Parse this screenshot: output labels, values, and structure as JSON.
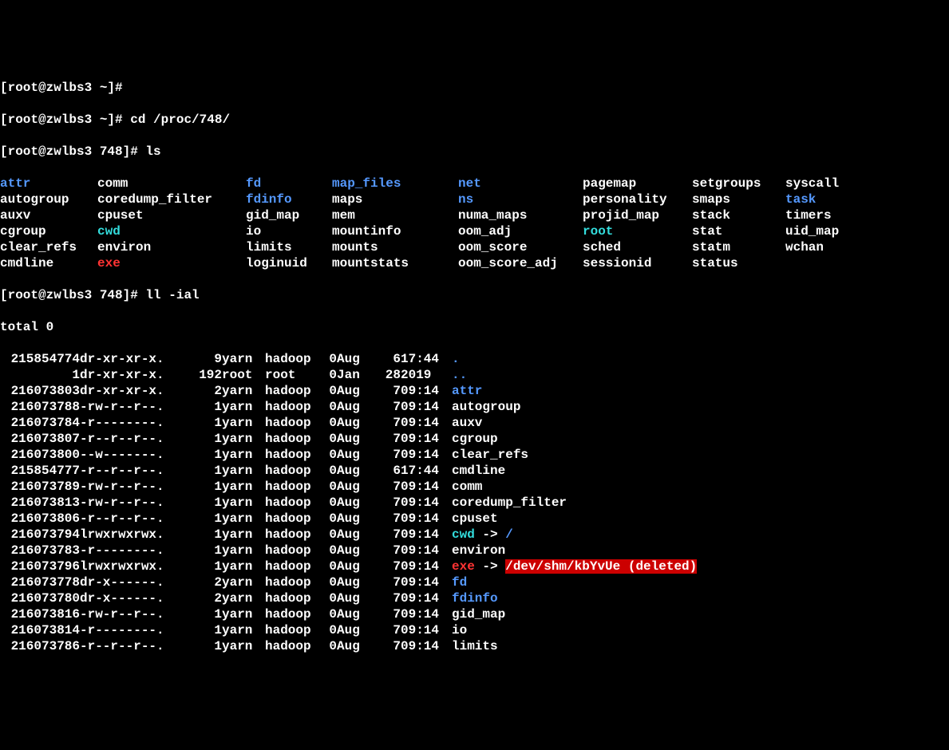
{
  "prompts": {
    "p0": "[root@zwlbs3 ~]# ",
    "p1": "[root@zwlbs3 ~]# cd /proc/748/",
    "p2": "[root@zwlbs3 748]# ls",
    "p3": "[root@zwlbs3 748]# ll -ial",
    "total": "total 0"
  },
  "ls": {
    "col1": [
      {
        "name": "attr",
        "cls": "blue"
      },
      {
        "name": "autogroup",
        "cls": "white"
      },
      {
        "name": "auxv",
        "cls": "white"
      },
      {
        "name": "cgroup",
        "cls": "white"
      },
      {
        "name": "clear_refs",
        "cls": "white"
      },
      {
        "name": "cmdline",
        "cls": "white"
      }
    ],
    "col2": [
      {
        "name": "comm",
        "cls": "white"
      },
      {
        "name": "coredump_filter",
        "cls": "white"
      },
      {
        "name": "cpuset",
        "cls": "white"
      },
      {
        "name": "cwd",
        "cls": "cyan"
      },
      {
        "name": "environ",
        "cls": "white"
      },
      {
        "name": "exe",
        "cls": "red"
      }
    ],
    "col3": [
      {
        "name": "fd",
        "cls": "blue"
      },
      {
        "name": "fdinfo",
        "cls": "blue"
      },
      {
        "name": "gid_map",
        "cls": "white"
      },
      {
        "name": "io",
        "cls": "white"
      },
      {
        "name": "limits",
        "cls": "white"
      },
      {
        "name": "loginuid",
        "cls": "white"
      }
    ],
    "col4": [
      {
        "name": "map_files",
        "cls": "blue"
      },
      {
        "name": "maps",
        "cls": "white"
      },
      {
        "name": "mem",
        "cls": "white"
      },
      {
        "name": "mountinfo",
        "cls": "white"
      },
      {
        "name": "mounts",
        "cls": "white"
      },
      {
        "name": "mountstats",
        "cls": "white"
      }
    ],
    "col5": [
      {
        "name": "net",
        "cls": "blue"
      },
      {
        "name": "ns",
        "cls": "blue"
      },
      {
        "name": "numa_maps",
        "cls": "white"
      },
      {
        "name": "oom_adj",
        "cls": "white"
      },
      {
        "name": "oom_score",
        "cls": "white"
      },
      {
        "name": "oom_score_adj",
        "cls": "white"
      }
    ],
    "col6": [
      {
        "name": "pagemap",
        "cls": "white"
      },
      {
        "name": "personality",
        "cls": "white"
      },
      {
        "name": "projid_map",
        "cls": "white"
      },
      {
        "name": "root",
        "cls": "cyan"
      },
      {
        "name": "sched",
        "cls": "white"
      },
      {
        "name": "sessionid",
        "cls": "white"
      }
    ],
    "col7": [
      {
        "name": "setgroups",
        "cls": "white"
      },
      {
        "name": "smaps",
        "cls": "white"
      },
      {
        "name": "stack",
        "cls": "white"
      },
      {
        "name": "stat",
        "cls": "white"
      },
      {
        "name": "statm",
        "cls": "white"
      },
      {
        "name": "status",
        "cls": "white"
      }
    ],
    "col8": [
      {
        "name": "syscall",
        "cls": "white"
      },
      {
        "name": "task",
        "cls": "blue"
      },
      {
        "name": "timers",
        "cls": "white"
      },
      {
        "name": "uid_map",
        "cls": "white"
      },
      {
        "name": "wchan",
        "cls": "white"
      }
    ]
  },
  "ll": [
    {
      "inode": "215854774",
      "perms": "dr-xr-xr-x.",
      "links": "9",
      "owner": "yarn",
      "group": "hadoop",
      "size": "0",
      "month": "Aug",
      "day": "6",
      "time": "17:44",
      "name": ".",
      "cls": "blue"
    },
    {
      "inode": "1",
      "perms": "dr-xr-xr-x.",
      "links": "192",
      "owner": "root",
      "group": "root",
      "size": "0",
      "month": "Jan",
      "day": "28",
      "time": "2019",
      "name": "..",
      "cls": "blue"
    },
    {
      "inode": "216073803",
      "perms": "dr-xr-xr-x.",
      "links": "2",
      "owner": "yarn",
      "group": "hadoop",
      "size": "0",
      "month": "Aug",
      "day": "7",
      "time": "09:14",
      "name": "attr",
      "cls": "blue"
    },
    {
      "inode": "216073788",
      "perms": "-rw-r--r--.",
      "links": "1",
      "owner": "yarn",
      "group": "hadoop",
      "size": "0",
      "month": "Aug",
      "day": "7",
      "time": "09:14",
      "name": "autogroup",
      "cls": "white"
    },
    {
      "inode": "216073784",
      "perms": "-r--------.",
      "links": "1",
      "owner": "yarn",
      "group": "hadoop",
      "size": "0",
      "month": "Aug",
      "day": "7",
      "time": "09:14",
      "name": "auxv",
      "cls": "white"
    },
    {
      "inode": "216073807",
      "perms": "-r--r--r--.",
      "links": "1",
      "owner": "yarn",
      "group": "hadoop",
      "size": "0",
      "month": "Aug",
      "day": "7",
      "time": "09:14",
      "name": "cgroup",
      "cls": "white"
    },
    {
      "inode": "216073800",
      "perms": "--w-------.",
      "links": "1",
      "owner": "yarn",
      "group": "hadoop",
      "size": "0",
      "month": "Aug",
      "day": "7",
      "time": "09:14",
      "name": "clear_refs",
      "cls": "white"
    },
    {
      "inode": "215854777",
      "perms": "-r--r--r--.",
      "links": "1",
      "owner": "yarn",
      "group": "hadoop",
      "size": "0",
      "month": "Aug",
      "day": "6",
      "time": "17:44",
      "name": "cmdline",
      "cls": "white"
    },
    {
      "inode": "216073789",
      "perms": "-rw-r--r--.",
      "links": "1",
      "owner": "yarn",
      "group": "hadoop",
      "size": "0",
      "month": "Aug",
      "day": "7",
      "time": "09:14",
      "name": "comm",
      "cls": "white"
    },
    {
      "inode": "216073813",
      "perms": "-rw-r--r--.",
      "links": "1",
      "owner": "yarn",
      "group": "hadoop",
      "size": "0",
      "month": "Aug",
      "day": "7",
      "time": "09:14",
      "name": "coredump_filter",
      "cls": "white"
    },
    {
      "inode": "216073806",
      "perms": "-r--r--r--.",
      "links": "1",
      "owner": "yarn",
      "group": "hadoop",
      "size": "0",
      "month": "Aug",
      "day": "7",
      "time": "09:14",
      "name": "cpuset",
      "cls": "white"
    },
    {
      "inode": "216073794",
      "perms": "lrwxrwxrwx.",
      "links": "1",
      "owner": "yarn",
      "group": "hadoop",
      "size": "0",
      "month": "Aug",
      "day": "7",
      "time": "09:14",
      "name": "cwd",
      "cls": "cyan",
      "arrow": " -> ",
      "target": "/",
      "tcls": "blue"
    },
    {
      "inode": "216073783",
      "perms": "-r--------.",
      "links": "1",
      "owner": "yarn",
      "group": "hadoop",
      "size": "0",
      "month": "Aug",
      "day": "7",
      "time": "09:14",
      "name": "environ",
      "cls": "white"
    },
    {
      "inode": "216073796",
      "perms": "lrwxrwxrwx.",
      "links": "1",
      "owner": "yarn",
      "group": "hadoop",
      "size": "0",
      "month": "Aug",
      "day": "7",
      "time": "09:14",
      "name": "exe",
      "cls": "red",
      "arrow": " -> ",
      "target": "/dev/shm/kbYvUe (deleted)",
      "tcls": "redbg"
    },
    {
      "inode": "216073778",
      "perms": "dr-x------.",
      "links": "2",
      "owner": "yarn",
      "group": "hadoop",
      "size": "0",
      "month": "Aug",
      "day": "7",
      "time": "09:14",
      "name": "fd",
      "cls": "blue"
    },
    {
      "inode": "216073780",
      "perms": "dr-x------.",
      "links": "2",
      "owner": "yarn",
      "group": "hadoop",
      "size": "0",
      "month": "Aug",
      "day": "7",
      "time": "09:14",
      "name": "fdinfo",
      "cls": "blue"
    },
    {
      "inode": "216073816",
      "perms": "-rw-r--r--.",
      "links": "1",
      "owner": "yarn",
      "group": "hadoop",
      "size": "0",
      "month": "Aug",
      "day": "7",
      "time": "09:14",
      "name": "gid_map",
      "cls": "white"
    },
    {
      "inode": "216073814",
      "perms": "-r--------.",
      "links": "1",
      "owner": "yarn",
      "group": "hadoop",
      "size": "0",
      "month": "Aug",
      "day": "7",
      "time": "09:14",
      "name": "io",
      "cls": "white"
    },
    {
      "inode": "216073786",
      "perms": "-r--r--r--.",
      "links": "1",
      "owner": "yarn",
      "group": "hadoop",
      "size": "0",
      "month": "Aug",
      "day": "7",
      "time": "09:14",
      "name": "limits",
      "cls": "white"
    }
  ]
}
